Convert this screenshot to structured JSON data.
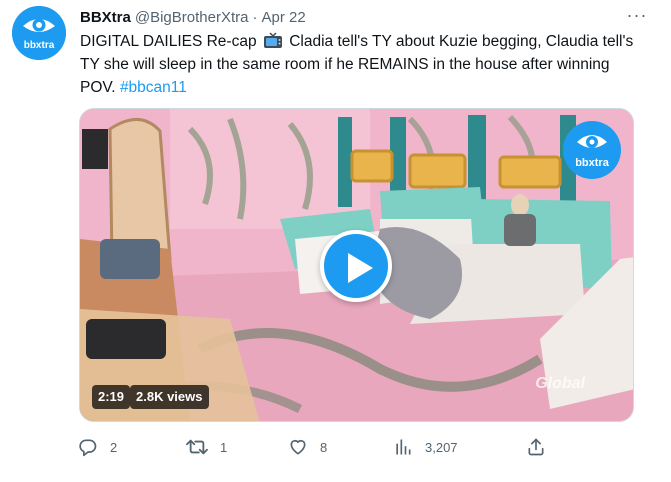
{
  "tweet": {
    "avatar_text": "bbxtra",
    "display_name": "BBXtra",
    "handle": "@BigBrotherXtra",
    "separator": "·",
    "time": "Apr 22",
    "text_before_icon": "DIGITAL DAILIES Re-cap",
    "text_after_icon": "Cladia tell's TY about Kuzie begging, Claudia tell's TY she will sleep in the same room if he REMAINS in the house after winning POV.",
    "hashtag": "#bbcan11",
    "more_label": "···"
  },
  "media": {
    "watermark_text": "bbxtra",
    "network_mark": "Global",
    "duration": "2:19",
    "views": "2.8K views"
  },
  "actions": {
    "replies": "2",
    "retweets": "1",
    "likes": "8",
    "views": "3,207"
  },
  "colors": {
    "accent": "#1d9bf0",
    "text": "#0f1419",
    "muted": "#536471"
  },
  "icons": {
    "more": "more-horizontal-icon",
    "tv": "television-emoji-icon",
    "play": "play-icon",
    "reply": "reply-icon",
    "retweet": "retweet-icon",
    "like": "heart-icon",
    "views": "analytics-bar-icon",
    "share": "share-icon"
  }
}
